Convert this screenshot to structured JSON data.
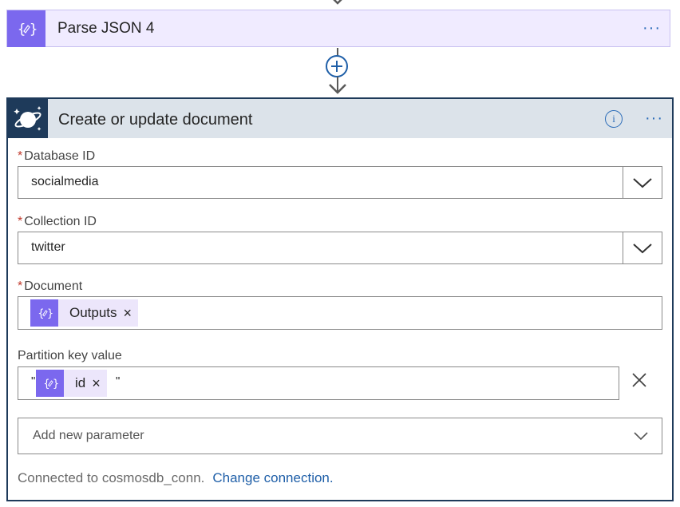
{
  "parse_step": {
    "title": "Parse JSON 4",
    "icon": "json-parse-icon",
    "more_label": "···"
  },
  "add_step": {
    "label": "+"
  },
  "action": {
    "title": "Create or update document",
    "icon": "cosmos-db-planet-icon",
    "info_label": "i",
    "more_label": "···",
    "fields": {
      "database": {
        "required_mark": "*",
        "label": "Database ID",
        "value": "socialmedia"
      },
      "collection": {
        "required_mark": "*",
        "label": "Collection ID",
        "value": "twitter"
      },
      "document": {
        "required_mark": "*",
        "label": "Document",
        "token": "Outputs",
        "token_remove": "×"
      },
      "partition": {
        "label": "Partition key value",
        "quote_open": "\"",
        "token": "id",
        "token_remove": "×",
        "quote_close": "\""
      }
    },
    "add_parameter": {
      "placeholder": "Add new parameter"
    },
    "footer": {
      "connected_text": "Connected to cosmosdb_conn.",
      "change_link": "Change connection."
    }
  },
  "colors": {
    "accent_purple": "#7b68ee",
    "link_blue": "#1f5fa8",
    "header_bg": "#dce3ea",
    "card_border": "#1e3a5a",
    "required_red": "#c0392b"
  }
}
